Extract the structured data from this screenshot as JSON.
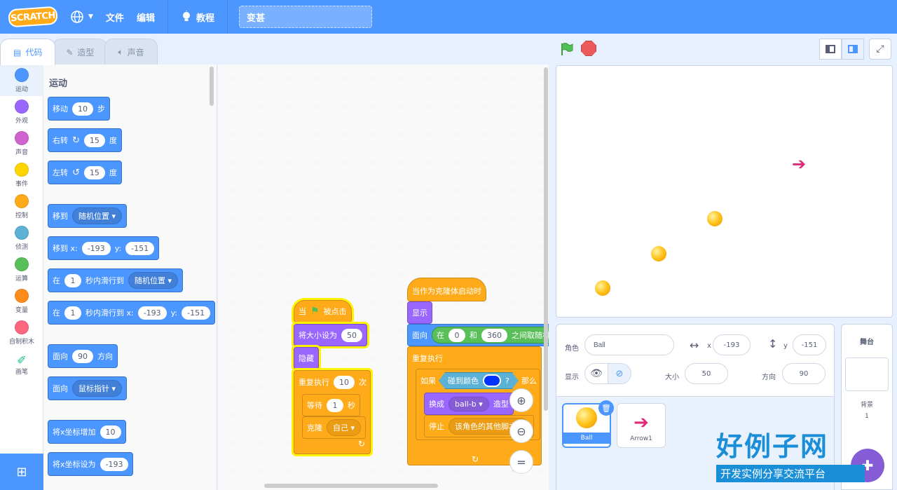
{
  "menubar": {
    "logo": "SCRATCH",
    "file": "文件",
    "edit": "编辑",
    "tutorials": "教程",
    "project_title": "变甚"
  },
  "tabs": [
    {
      "label": "代码",
      "icon": "code-icon"
    },
    {
      "label": "造型",
      "icon": "brush-icon"
    },
    {
      "label": "声音",
      "icon": "speaker-icon"
    }
  ],
  "categories": [
    {
      "label": "运动",
      "color": "#4c97ff"
    },
    {
      "label": "外观",
      "color": "#9966ff"
    },
    {
      "label": "声音",
      "color": "#cf63cf"
    },
    {
      "label": "事件",
      "color": "#ffd500"
    },
    {
      "label": "控制",
      "color": "#ffab19"
    },
    {
      "label": "侦测",
      "color": "#5cb1d6"
    },
    {
      "label": "运算",
      "color": "#59c059"
    },
    {
      "label": "变量",
      "color": "#ff8c1a"
    },
    {
      "label": "自制积木",
      "color": "#ff6680"
    },
    {
      "label": "画笔",
      "color": "#0fbd8c"
    }
  ],
  "palette": {
    "title": "运动",
    "move": {
      "label": "移动",
      "steps": "10",
      "unit": "步"
    },
    "turn_right": {
      "label": "右转",
      "deg": "15",
      "unit": "度"
    },
    "turn_left": {
      "label": "左转",
      "deg": "15",
      "unit": "度"
    },
    "goto": {
      "label": "移到",
      "target": "随机位置"
    },
    "goto_xy": {
      "label": "移到 x:",
      "x": "-193",
      "ylabel": "y:",
      "y": "-151"
    },
    "glide": {
      "label": "在",
      "secs": "1",
      "mid": "秒内滑行到",
      "target": "随机位置"
    },
    "glide_xy": {
      "label": "在",
      "secs": "1",
      "mid": "秒内滑行到 x:",
      "x": "-193",
      "ylabel": "y:",
      "y": "-151"
    },
    "point": {
      "label": "面向",
      "deg": "90",
      "unit": "方向"
    },
    "point_towards": {
      "label": "面向",
      "target": "鼠标指针"
    },
    "change_x": {
      "label": "将x坐标增加",
      "value": "10"
    },
    "set_x": {
      "label": "将x坐标设为",
      "value": "-193"
    }
  },
  "script1": {
    "hat": "当",
    "hat_end": "被点击",
    "set_size": "将大小设为",
    "size": "50",
    "hide": "隐藏",
    "repeat": "重复执行",
    "times": "10",
    "times_unit": "次",
    "wait": "等待",
    "wait_secs": "1",
    "wait_unit": "秒",
    "clone": "克隆",
    "clone_target": "自己"
  },
  "script2": {
    "hat": "当作为克隆体启动时",
    "show": "显示",
    "point": "面向",
    "random_pre": "在",
    "from": "0",
    "and": "和",
    "to": "360",
    "random_post": "之间取随机数",
    "forever": "重复执行",
    "if": "如果",
    "touching_color": "碰到颜色",
    "question": "?",
    "then": "那么",
    "switch_costume": "换成",
    "costume": "ball-b",
    "costume_post": "造型",
    "stop": "停止",
    "stop_target": "该角色的其他脚本"
  },
  "zoom": {
    "in": "+",
    "out": "−",
    "reset": "="
  },
  "sprite_info": {
    "sprite_label": "角色",
    "sprite_name": "Ball",
    "x_label": "x",
    "x": "-193",
    "y_label": "y",
    "y": "-151",
    "show_label": "显示",
    "size_label": "大小",
    "size": "50",
    "direction_label": "方向",
    "direction": "90"
  },
  "sprites": [
    {
      "name": "Ball"
    },
    {
      "name": "Arrow1"
    }
  ],
  "backdrop": {
    "title": "舞台",
    "label": "背景",
    "count": "1"
  },
  "watermark": {
    "main": "好例子网",
    "sub": "开发实例分享交流平台"
  },
  "colors": {
    "accent": "#4c97ff",
    "motion": "#4c97ff",
    "looks": "#9966ff",
    "control": "#ffab19",
    "operators": "#59c059",
    "sensing": "#5cb1d6"
  }
}
